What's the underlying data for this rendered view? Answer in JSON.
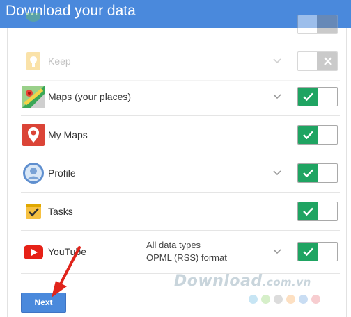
{
  "header": {
    "title": "Download your data"
  },
  "rows": [
    {
      "label": "",
      "toggle": "off"
    },
    {
      "label": "Keep",
      "toggle": "off"
    },
    {
      "label": "Maps (your places)",
      "toggle": "on"
    },
    {
      "label": "My Maps",
      "toggle": "on"
    },
    {
      "label": "Profile",
      "toggle": "on"
    },
    {
      "label": "Tasks",
      "toggle": "on"
    },
    {
      "label": "YouTube",
      "toggle": "on",
      "types": [
        "All data types",
        "OPML (RSS) format"
      ]
    }
  ],
  "next_button": {
    "label": "Next"
  },
  "watermark": {
    "text": "Download",
    "suffix": ".com.vn"
  },
  "colors": {
    "header": "#4a89dc",
    "toggle_on": "#1fa462",
    "toggle_off": "#8b8b8b",
    "button": "#4a89dc",
    "arrow": "#e0241b"
  }
}
